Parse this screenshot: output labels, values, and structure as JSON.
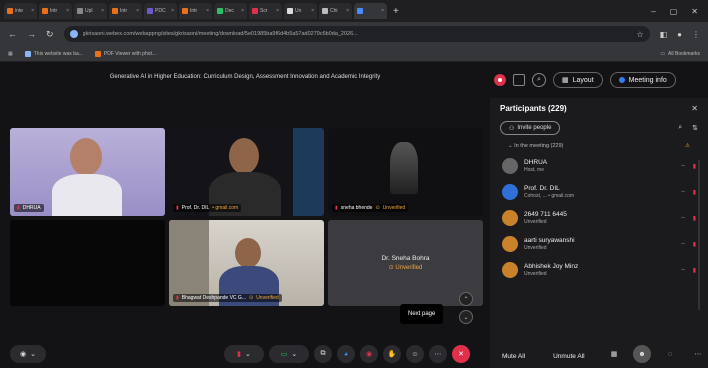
{
  "browser": {
    "tabs": [
      {
        "label": "inte",
        "color": "#e8711a",
        "active": false
      },
      {
        "label": "Intr",
        "color": "#e8711a",
        "active": false
      },
      {
        "label": "Upl",
        "color": "#888888",
        "active": false
      },
      {
        "label": "Intr",
        "color": "#e8711a",
        "active": false
      },
      {
        "label": "PDC",
        "color": "#6a5acd",
        "active": false
      },
      {
        "label": "Intr",
        "color": "#e8711a",
        "active": false
      },
      {
        "label": "Dec",
        "color": "#2bbf6a",
        "active": false
      },
      {
        "label": "Scr",
        "color": "#e0314b",
        "active": false
      },
      {
        "label": "Un",
        "color": "#dddddd",
        "active": false
      },
      {
        "label": "Chi",
        "color": "#bbbbbb",
        "active": false
      },
      {
        "label": "",
        "color": "#4a8cff",
        "active": true
      }
    ],
    "url": "gkrisaoni.webex.com/webappng/sites/gkrisaoni/meeting/download/5e01985ba9f6d4b5a57ad0279c6b0da_2026...",
    "bookmarks": [
      {
        "label": "This website was ba..."
      },
      {
        "label": "PDF Viewer with phot..."
      }
    ],
    "all_bookmarks": "All Bookmarks"
  },
  "meeting": {
    "title": "Generative AI in Higher Education: Curriculum Design, Assessment Innovation and Academic Integrity",
    "layout_label": "Layout",
    "meeting_info_label": "Meeting info",
    "tiles": [
      {
        "name": "DHRUA",
        "status": ""
      },
      {
        "name": "Prof. Dr. DIL",
        "status": "• gmail.com"
      },
      {
        "name": "sneha bhende",
        "status": "Unverified"
      },
      {
        "name": "",
        "status": ""
      },
      {
        "name": "Bhagwat Deshpande VC G...",
        "status": "Unverified"
      },
      {
        "name": "Dr. Sneha Bohra",
        "status": "Unverified"
      }
    ],
    "tooltip": "Next page"
  },
  "participants": {
    "title": "Participants (229)",
    "invite_label": "Invite people",
    "section": "In the meeting (229)",
    "list": [
      {
        "name": "DHRUA",
        "sub": "Host, me",
        "avatar_color": "#666666",
        "unverified": false
      },
      {
        "name": "Prof. Dr. DIL",
        "sub": "Cohost, ... • gmail.com",
        "avatar_color": "#2f6fd6",
        "unverified": false
      },
      {
        "name": "2649 711 6445",
        "sub": "Unverified",
        "avatar_color": "#c9822a",
        "unverified": true
      },
      {
        "name": "aarti suryawanshi",
        "sub": "Unverified",
        "avatar_color": "#c9822a",
        "unverified": true
      },
      {
        "name": "Abhishek Joy Minz",
        "sub": "Unverified",
        "avatar_color": "#c9822a",
        "unverified": true
      }
    ],
    "mute_all": "Mute All",
    "unmute_all": "Unmute All"
  }
}
